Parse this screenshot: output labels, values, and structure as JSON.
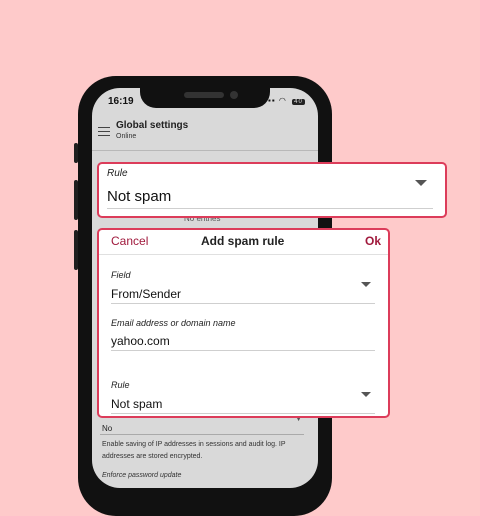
{
  "status": {
    "time": "16:19",
    "battery": "40"
  },
  "app": {
    "title": "Global settings",
    "subtitle": "Online",
    "empty_text": "No entries"
  },
  "rule_card": {
    "label": "Rule",
    "value": "Not spam"
  },
  "dialog": {
    "cancel": "Cancel",
    "title": "Add spam rule",
    "ok": "Ok",
    "field_label": "Field",
    "field_value": "From/Sender",
    "email_label": "Email address or domain name",
    "email_value": "yahoo.com",
    "rule_label": "Rule",
    "rule_value": "Not spam"
  },
  "background": {
    "select_value": "No",
    "help_line1": "Enable saving of IP addresses in sessions and audit log. IP",
    "help_line2": "addresses are stored encrypted.",
    "enforce_label": "Enforce password update"
  },
  "colors": {
    "accent": "#a0193c",
    "highlight_border": "#dc3c5a",
    "background": "#fecaca"
  }
}
